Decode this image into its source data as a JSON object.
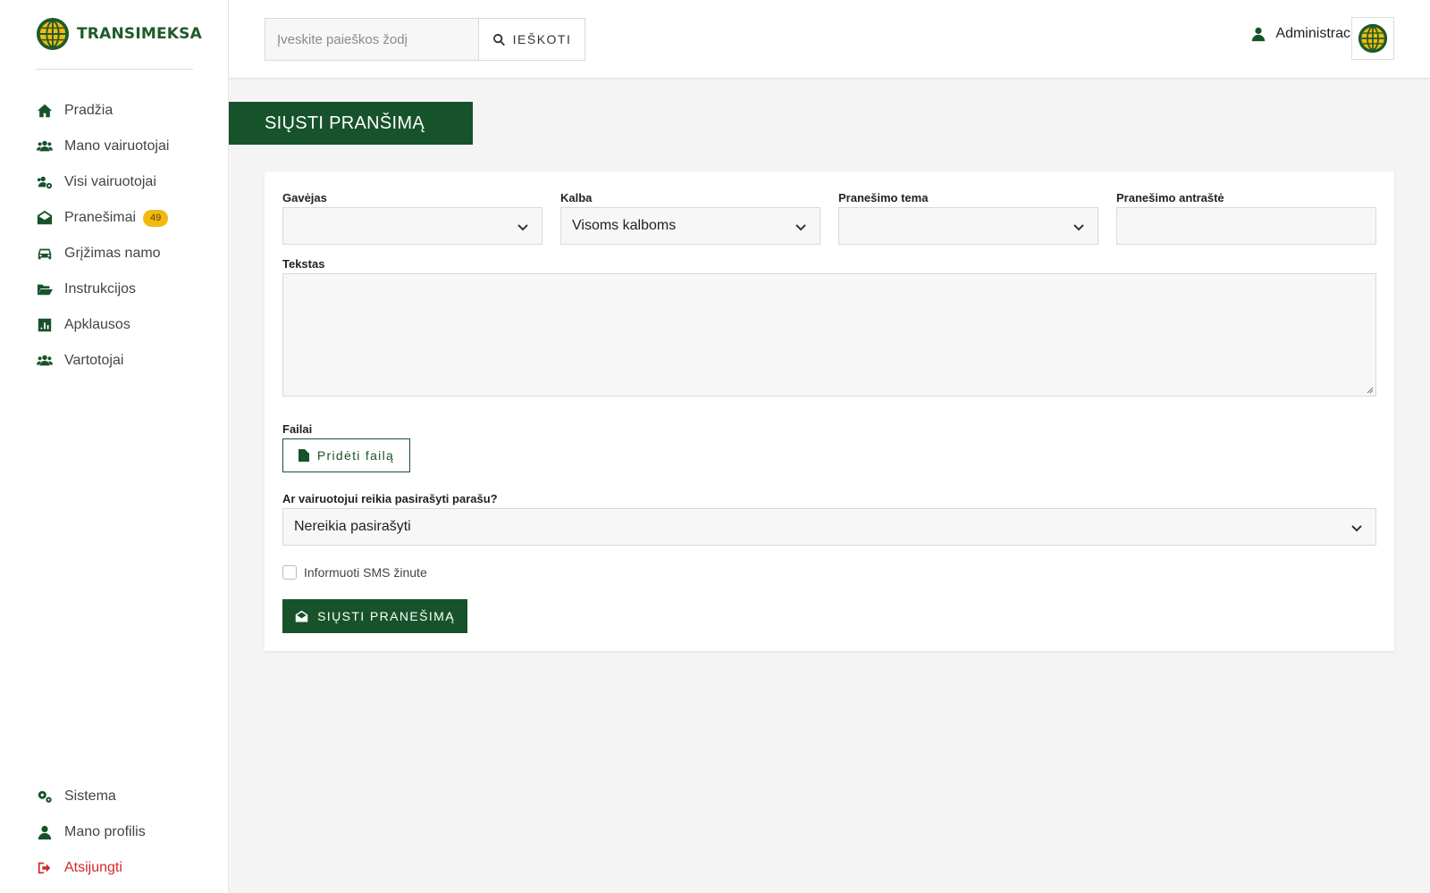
{
  "brand": {
    "name": "TRANSIMEKSA",
    "color": "#17532a",
    "accent": "#f2b90f"
  },
  "sidebar": {
    "items": [
      {
        "label": "Pradžia",
        "icon": "home-icon"
      },
      {
        "label": "Mano vairuotojai",
        "icon": "users-icon"
      },
      {
        "label": "Visi vairuotojai",
        "icon": "users-gear-icon"
      },
      {
        "label": "Pranešimai",
        "icon": "envelope-open-icon",
        "badge": "49"
      },
      {
        "label": "Grįžimas namo",
        "icon": "car-icon"
      },
      {
        "label": "Instrukcijos",
        "icon": "folder-open-icon"
      },
      {
        "label": "Apklausos",
        "icon": "chart-icon"
      },
      {
        "label": "Vartotojai",
        "icon": "users-icon"
      }
    ],
    "bottom_items": [
      {
        "label": "Sistema",
        "icon": "gears-icon"
      },
      {
        "label": "Mano profilis",
        "icon": "user-icon"
      },
      {
        "label": "Atsijungti",
        "icon": "sign-out-icon"
      }
    ]
  },
  "topbar": {
    "search_placeholder": "Įveskite paieškos žodį",
    "search_button": "IEŠKOTI",
    "user_label": "Administracija"
  },
  "page": {
    "title": "SIŲSTI PRANŠIMĄ"
  },
  "form": {
    "recipient_label": "Gavėjas",
    "recipient_value": "",
    "language_label": "Kalba",
    "language_value": "Visoms kalboms",
    "topic_label": "Pranešimo tema",
    "topic_value": "",
    "heading_label": "Pranešimo antraštė",
    "heading_value": "",
    "text_label": "Tekstas",
    "files_label": "Failai",
    "add_file_button": "Pridėti failą",
    "signature_label": "Ar vairuotojui reikia pasirašyti parašu?",
    "signature_value": "Nereikia pasirašyti",
    "sms_label": "Informuoti SMS žinute",
    "sms_checked": false,
    "send_button": "SIŲSTI PRANEŠIMĄ"
  }
}
